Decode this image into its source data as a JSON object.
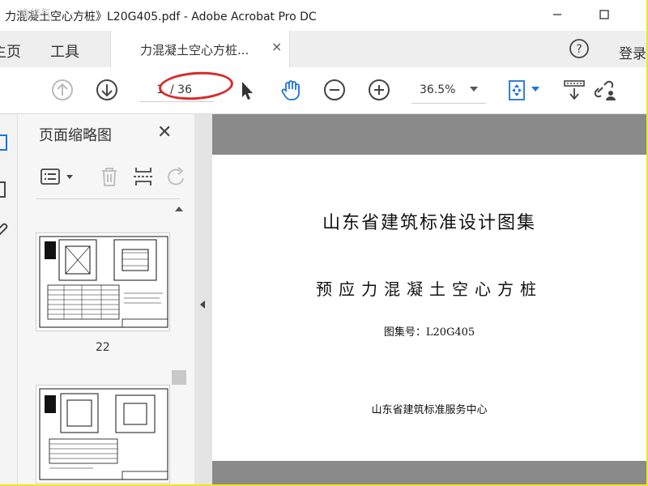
{
  "titlebar": {
    "title": "力混凝土空心方桩》L20G405.pdf - Adobe Acrobat Pro DC",
    "watermark": "逸修气"
  },
  "tabbar": {
    "menu_home": "主页",
    "menu_tools": "工具",
    "active_tab": "力混凝土空心方桩...",
    "tab_close": "×",
    "login": "登录"
  },
  "toolbar": {
    "current_page": "1",
    "total_pages": "/ 36",
    "zoom": "36.5%"
  },
  "panel": {
    "title": "页面缩略图",
    "close": "✕",
    "thumbnails": [
      {
        "page_number": "22"
      },
      {
        "page_number": ""
      }
    ]
  },
  "document": {
    "line1": "山东省建筑标准设计图集",
    "line2": "预应力混凝土空心方桩",
    "line3": "图集号：L20G405",
    "line4": "山东省建筑标准服务中心"
  },
  "colors": {
    "frame_border": "#f1e326",
    "annotation_red": "#d92a2a",
    "icon_blue": "#1a73d9",
    "doc_background": "#8a8a8a"
  },
  "icons": {
    "prev_page": "arrow-up-circle-icon",
    "next_page": "arrow-down-circle-icon",
    "select": "cursor-arrow-icon",
    "hand": "hand-icon",
    "zoom_out": "minus-circle-icon",
    "zoom_in": "plus-circle-icon",
    "fit": "fit-page-icon",
    "scroll_mode": "scroll-mode-icon",
    "share_link": "link-user-icon"
  }
}
